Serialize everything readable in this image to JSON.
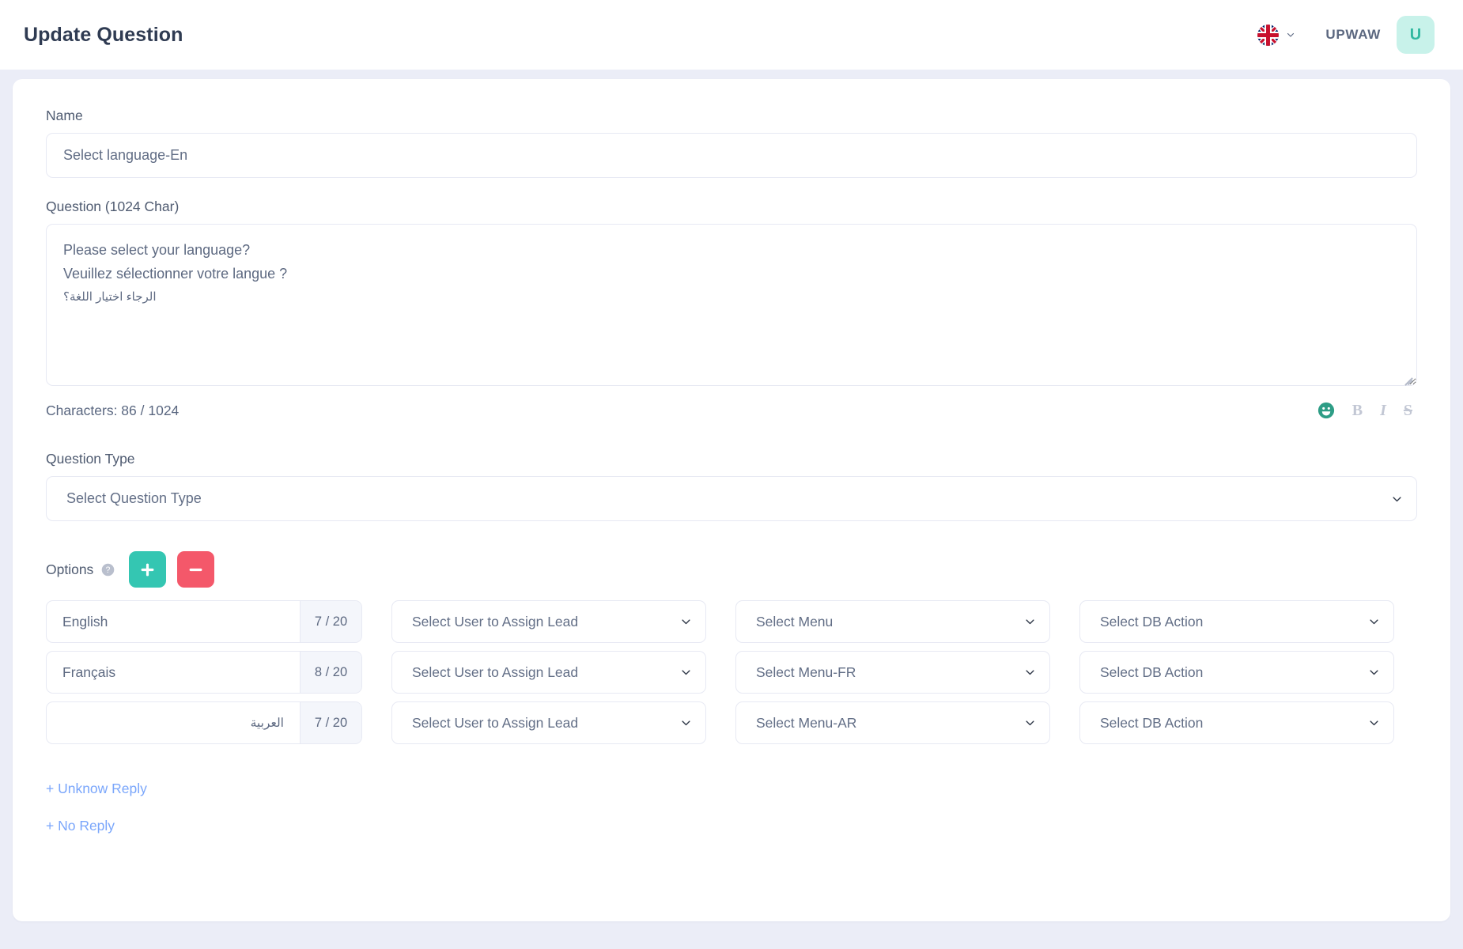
{
  "header": {
    "title": "Update Question",
    "flag_icon": "uk-flag-icon",
    "lang_chevron_icon": "chevron-down-icon",
    "org_name": "UPWAW",
    "avatar_initial": "U"
  },
  "form": {
    "name": {
      "label": "Name",
      "value": "Select language-En",
      "placeholder": "Name"
    },
    "question": {
      "label": "Question (1024 Char)",
      "lines": [
        "Please select your language?",
        "Veuillez sélectionner votre langue ?",
        "الرجاء اختيار اللغة؟"
      ],
      "placeholder": "Question",
      "char_count": "Characters: 86 / 1024",
      "tools": {
        "emoji": "emoji-smiley-icon",
        "bold": "B",
        "italic": "I",
        "strike": "S"
      }
    },
    "question_type": {
      "label": "Question Type",
      "selected": "Select Question Type",
      "chevron_icon": "chevron-down-icon"
    },
    "options": {
      "label": "Options",
      "help_icon": "help-circle-icon",
      "add_icon": "plus-icon",
      "remove_icon": "minus-icon",
      "add_color": "#34c6b2",
      "remove_color": "#f4586a",
      "rows": [
        {
          "name": "English",
          "rtl": false,
          "counter": "7 / 20",
          "user_select": "Select User to Assign Lead",
          "menu_select": "Select Menu",
          "db_select": "Select DB Action"
        },
        {
          "name": "Français",
          "rtl": false,
          "counter": "8 / 20",
          "user_select": "Select User to Assign Lead",
          "menu_select": "Select Menu-FR",
          "db_select": "Select DB Action"
        },
        {
          "name": "العربية",
          "rtl": true,
          "counter": "7 / 20",
          "user_select": "Select User to Assign Lead",
          "menu_select": "Select Menu-AR",
          "db_select": "Select DB Action"
        }
      ]
    },
    "links": [
      {
        "label": "+ Unknow Reply"
      },
      {
        "label": "+ No Reply"
      }
    ]
  },
  "colors": {
    "page_bg": "#ebedf7",
    "link": "#7aa6fb",
    "avatar_bg": "#c8f2ea",
    "avatar_fg": "#2fb8a0"
  }
}
